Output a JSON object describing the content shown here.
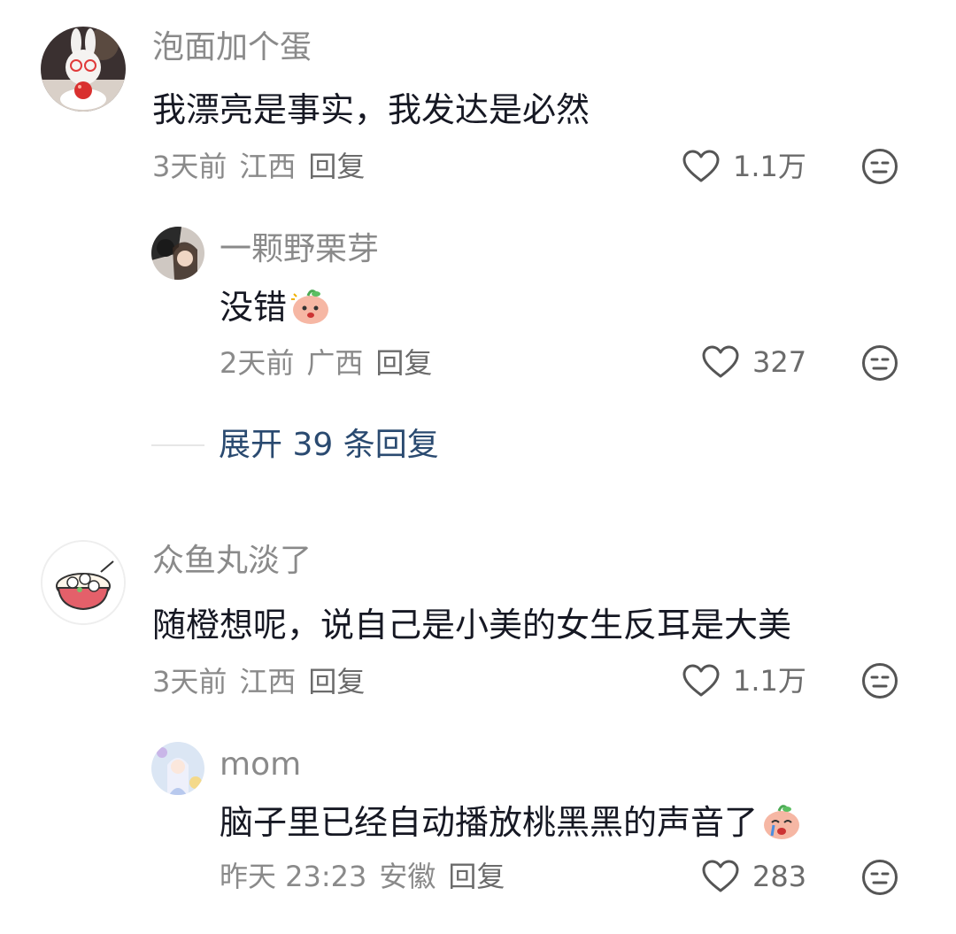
{
  "comments": [
    {
      "name": "泡面加个蛋",
      "text": "我漂亮是事实，我发达是必然",
      "time": "3天前",
      "location": "江西",
      "reply_label": "回复",
      "likes": "1.1万",
      "replies": [
        {
          "name": "一颗野栗芽",
          "text": "没错",
          "time": "2天前",
          "location": "广西",
          "reply_label": "回复",
          "likes": "327"
        }
      ],
      "expand_label": "展开 39 条回复"
    },
    {
      "name": "众鱼丸淡了",
      "text": "随橙想呢，说自己是小美的女生反耳是大美",
      "time": "3天前",
      "location": "江西",
      "reply_label": "回复",
      "likes": "1.1万",
      "replies": [
        {
          "name": "mom",
          "text": "脑子里已经自动播放桃黑黑的声音了",
          "time": "昨天 23:23",
          "location": "安徽",
          "reply_label": "回复",
          "likes": "283"
        }
      ]
    }
  ],
  "colors": {
    "name": "#8a8a8a",
    "text": "#161823",
    "link": "#2a4a70"
  }
}
